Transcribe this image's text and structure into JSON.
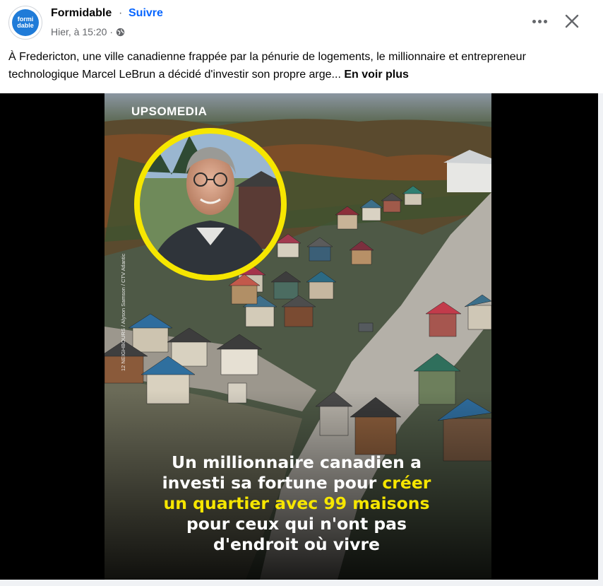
{
  "post": {
    "page_name": "Formidable",
    "separator": "·",
    "follow_label": "Suivre",
    "timestamp": "Hier, à 15:20",
    "meta_dot": "·",
    "avatar_text_line1": "formi",
    "avatar_text_line2": "dable",
    "caption": "À Fredericton, une ville canadienne frappée par la pénurie de logements, le millionnaire et entrepreneur technologique Marcel LeBrun a décidé d'investir son propre arge...",
    "see_more": "En voir plus",
    "more_icon": "more-options-icon",
    "close_icon": "close-icon",
    "privacy_icon": "globe-icon"
  },
  "image": {
    "brand": "UPSOMEDIA",
    "credit": "12 NEIGHBOURS / Alyson Samson / CTV Atlantic",
    "headline_white_1": "Un millionnaire canadien a",
    "headline_white_2": "investi sa fortune pour ",
    "headline_yellow_1": "créer",
    "headline_yellow_2": "un quartier avec 99 maisons",
    "headline_white_3": "pour ceux qui n'ont pas",
    "headline_white_4": "d'endroit où vivre"
  },
  "colors": {
    "accent": "#0866ff",
    "headline_highlight": "#f6e600",
    "portrait_ring": "#f6e600"
  }
}
